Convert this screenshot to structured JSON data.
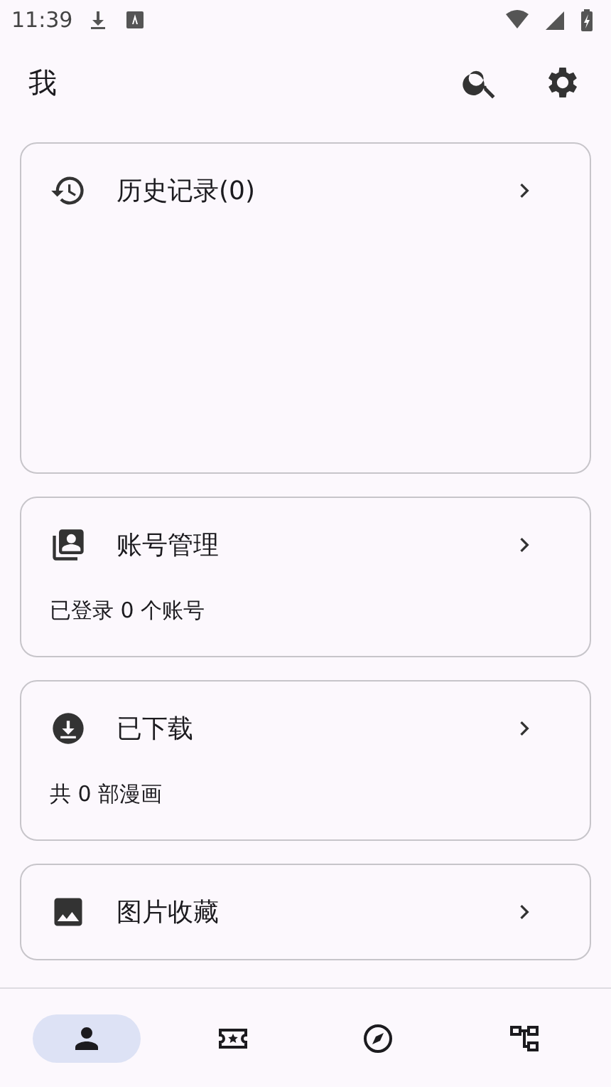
{
  "status_bar": {
    "time": "11:39"
  },
  "app_bar": {
    "title": "我"
  },
  "cards": [
    {
      "kind": "history",
      "title": "历史记录(0)"
    },
    {
      "kind": "accounts",
      "title": "账号管理",
      "subtitle": "已登录 0 个账号"
    },
    {
      "kind": "downloads",
      "title": "已下载",
      "subtitle": "共 0 部漫画"
    },
    {
      "kind": "images",
      "title": "图片收藏"
    }
  ],
  "bottom_nav": [
    {
      "kind": "me",
      "selected": true
    },
    {
      "kind": "ticket",
      "selected": false
    },
    {
      "kind": "explore",
      "selected": false
    },
    {
      "kind": "categories",
      "selected": false
    }
  ]
}
